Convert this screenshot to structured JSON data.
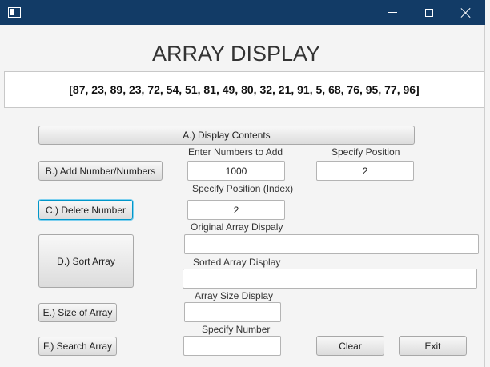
{
  "heading": "ARRAY DISPLAY",
  "array_display": "[87, 23, 89, 23, 72, 54, 51, 81, 49, 80, 32, 21, 91, 5, 68, 76, 95, 77, 96]",
  "buttons": {
    "display_contents": "A.) Display Contents",
    "add_numbers": "B.) Add Number/Numbers",
    "delete_number": "C.) Delete Number",
    "sort_array": "D.) Sort Array",
    "size_of_array": "E.) Size of Array",
    "search_array": "F.) Search Array",
    "clear": "Clear",
    "exit": "Exit"
  },
  "labels": {
    "enter_numbers": "Enter Numbers to Add",
    "specify_position": "Specify Position",
    "specify_position_index": "Specify Position (Index)",
    "original_array": "Original Array Dispaly",
    "sorted_array": "Sorted Array Display",
    "array_size": "Array Size Display",
    "specify_number": "Specify Number"
  },
  "fields": {
    "numbers_to_add": "1000",
    "position": "2",
    "delete_index": "2",
    "original_array": "",
    "sorted_array": "",
    "array_size": "",
    "search_number": ""
  },
  "colors": {
    "titlebar": "#123b66",
    "focus_ring": "#0096c9",
    "window_background": "#f4f4f4"
  },
  "icons": {
    "app": "app-window-icon",
    "minimize": "minimize-icon",
    "maximize": "maximize-icon",
    "close": "close-icon"
  }
}
